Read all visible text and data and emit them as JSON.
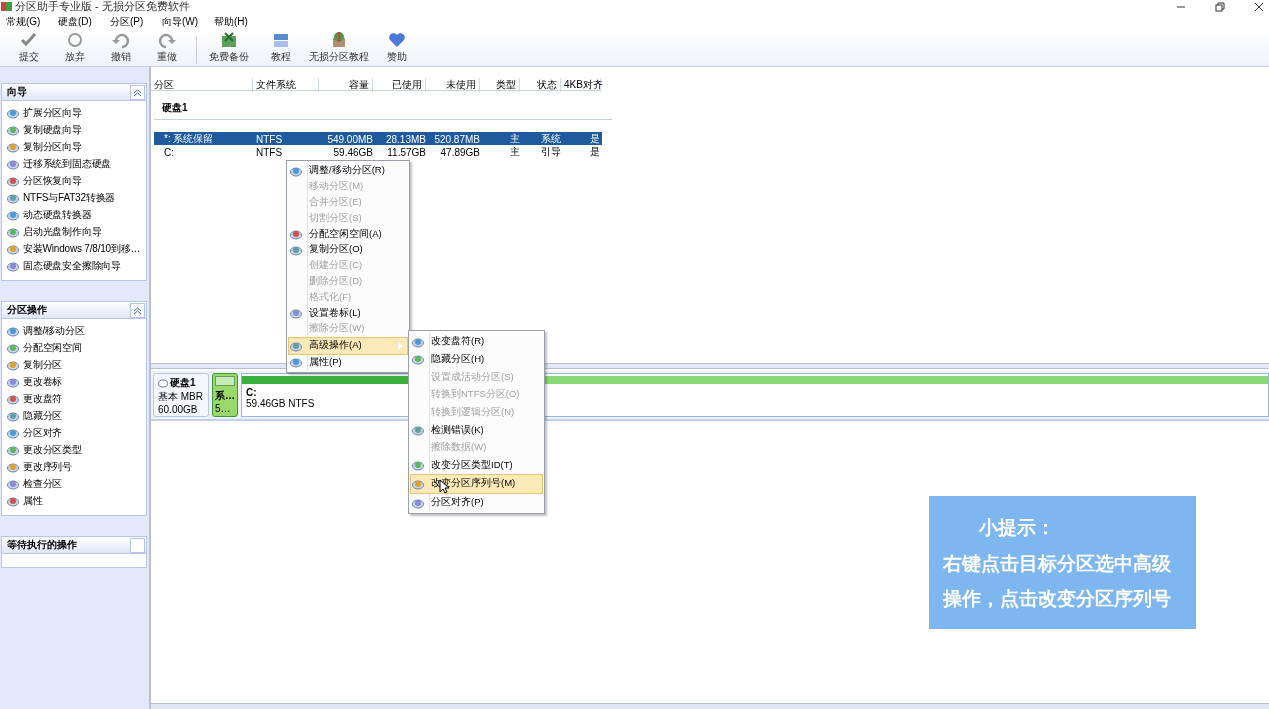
{
  "window": {
    "title": "分区助手专业版 - 无损分区免费软件"
  },
  "menu": [
    "常规(G)",
    "硬盘(D)",
    "分区(P)",
    "向导(W)",
    "帮助(H)"
  ],
  "toolbar": [
    {
      "label": "提交",
      "kind": "check"
    },
    {
      "label": "放弃",
      "kind": "discard"
    },
    {
      "label": "撤销",
      "kind": "undo"
    },
    {
      "label": "重做",
      "kind": "redo"
    },
    {
      "label": "免费备份",
      "kind": "backup"
    },
    {
      "label": "教程",
      "kind": "book"
    },
    {
      "label": "无损分区教程",
      "kind": "shield"
    },
    {
      "label": "赞助",
      "kind": "heart"
    }
  ],
  "sidebar": [
    {
      "title": "向导",
      "items": [
        "扩展分区向导",
        "复制硬盘向导",
        "复制分区向导",
        "迁移系统到固态硬盘",
        "分区恢复向导",
        "NTFS与FAT32转换器",
        "动态硬盘转换器",
        "启动光盘制作向导",
        "安装Windows 7/8/10到移…",
        "固态硬盘安全擦除向导"
      ]
    },
    {
      "title": "分区操作",
      "items": [
        "调整/移动分区",
        "分配空闲空间",
        "复制分区",
        "更改卷标",
        "更改盘符",
        "隐藏分区",
        "分区对齐",
        "更改分区类型",
        "更改序列号",
        "检查分区",
        "属性"
      ]
    },
    {
      "title": "等待执行的操作"
    }
  ],
  "table": {
    "columns": [
      "分区",
      "文件系统",
      "容量",
      "已使用",
      "未使用",
      "类型",
      "状态",
      "4KB对齐"
    ],
    "disk": "硬盘1",
    "rows": [
      {
        "selected": true,
        "cells": [
          "*: 系统保留",
          "NTFS",
          "549.00MB",
          "28.13MB",
          "520.87MB",
          "主",
          "系统",
          "是"
        ]
      },
      {
        "selected": false,
        "cells": [
          "C:",
          "NTFS",
          "59.46GB",
          "11.57GB",
          "47.89GB",
          "主",
          "引导",
          "是"
        ]
      }
    ]
  },
  "disk_map": {
    "name": "硬盘1",
    "type": "基本 MBR",
    "size": "60.00GB",
    "partitions": [
      {
        "name": "系…",
        "size": "5…",
        "selected": true
      },
      {
        "name": "C:",
        "size": "59.46GB NTFS",
        "selected": false
      }
    ]
  },
  "context_menu": [
    {
      "label": "调整/移动分区(R)",
      "disabled": false
    },
    {
      "label": "移动分区(M)",
      "disabled": true
    },
    {
      "label": "合并分区(E)",
      "disabled": true
    },
    {
      "label": "切割分区(S)",
      "disabled": true
    },
    {
      "label": "分配空闲空间(A)",
      "disabled": false
    },
    {
      "label": "复制分区(O)",
      "disabled": false
    },
    {
      "label": "创建分区(C)",
      "disabled": true
    },
    {
      "label": "删除分区(D)",
      "disabled": true
    },
    {
      "label": "格式化(F)",
      "disabled": true
    },
    {
      "label": "设置卷标(L)",
      "disabled": false
    },
    {
      "label": "擦除分区(W)",
      "disabled": true
    },
    {
      "label": "高级操作(A)",
      "disabled": false,
      "selected": true,
      "submenu": true
    },
    {
      "label": "属性(P)",
      "disabled": false
    }
  ],
  "submenu": [
    {
      "label": "改变盘符(R)",
      "disabled": false,
      "selected": false
    },
    {
      "label": "隐藏分区(H)",
      "disabled": false,
      "selected": false
    },
    {
      "label": "设置成活动分区(S)",
      "disabled": true,
      "selected": false
    },
    {
      "label": "转换到NTFS分区(O)",
      "disabled": true,
      "selected": false
    },
    {
      "label": "转换到逻辑分区(N)",
      "disabled": true,
      "selected": false
    },
    {
      "label": "检测错误(K)",
      "disabled": false,
      "selected": false
    },
    {
      "label": "擦除数据(W)",
      "disabled": true,
      "selected": false
    },
    {
      "label": "改变分区类型ID(T)",
      "disabled": false,
      "selected": false
    },
    {
      "label": "改变分区序列号(M)",
      "disabled": false,
      "selected": true
    },
    {
      "label": "分区对齐(P)",
      "disabled": false,
      "selected": false
    }
  ],
  "tip": {
    "title": "小提示：",
    "text": "右键点击目标分区选中高级操作，点击改变分区序列号"
  }
}
